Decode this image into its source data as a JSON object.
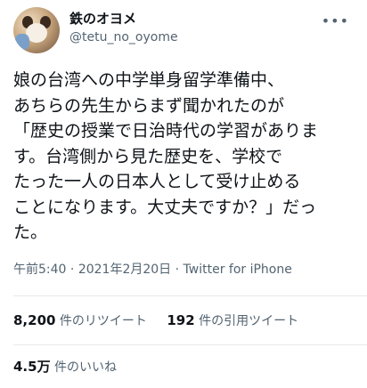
{
  "author": {
    "display_name": "鉄のオヨメ",
    "handle": "@tetu_no_oyome",
    "avatar_icon": "user-avatar-icon"
  },
  "more_icon": "more-dots-icon",
  "tweet": {
    "text": "娘の台湾への中学単身留学準備中、\nあちらの先生からまず聞かれたのが\n「歴史の授業で日治時代の学習がありま\nす。台湾側から見た歴史を、学校で\nたった一人の日本人として受け止める\nことになります。大丈夫ですか？」だっ\nた。"
  },
  "meta": {
    "time": "午前5:40",
    "separator": "·",
    "date": "2021年2月20日",
    "source": "Twitter for iPhone"
  },
  "stats": {
    "retweets_count": "8,200",
    "retweets_label": "件のリツイート",
    "quotes_count": "192",
    "quotes_label": "件の引用ツイート",
    "likes_count": "4.5万",
    "likes_label": "件のいいね"
  }
}
